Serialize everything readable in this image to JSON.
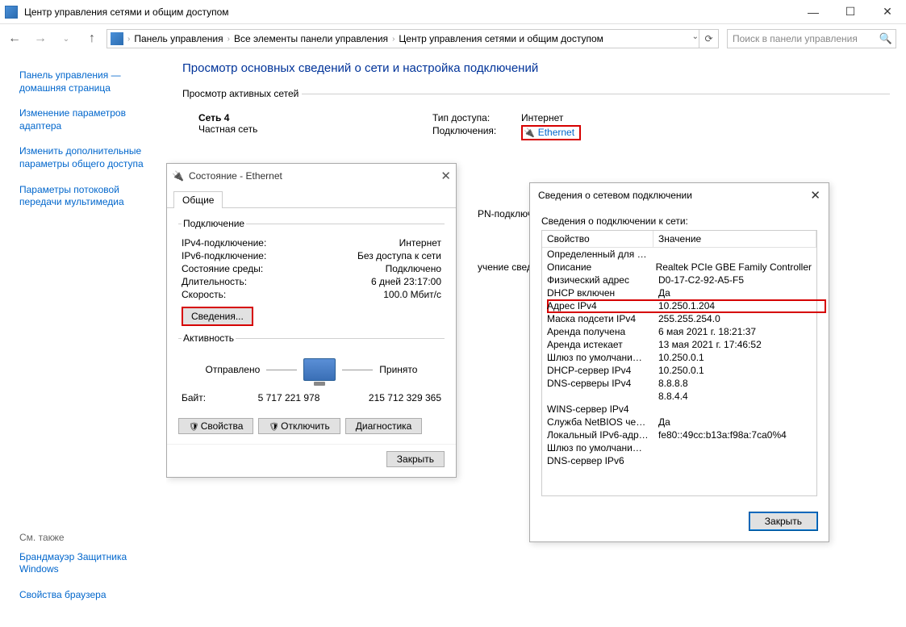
{
  "window": {
    "title": "Центр управления сетями и общим доступом",
    "minimize": "—",
    "maximize": "☐",
    "close": "✕"
  },
  "nav": {
    "back": "←",
    "forward": "→",
    "up": "↑",
    "refresh": "⟳",
    "dropdown": "⌄",
    "breadcrumb": [
      "Панель управления",
      "Все элементы панели управления",
      "Центр управления сетями и общим доступом"
    ],
    "sep": "›"
  },
  "search": {
    "placeholder": "Поиск в панели управления"
  },
  "sidebar": {
    "items": [
      "Панель управления — домашняя страница",
      "Изменение параметров адаптера",
      "Изменить дополнительные параметры общего доступа",
      "Параметры потоковой передачи мультимедиа"
    ],
    "see_also_title": "См. также",
    "see_also": [
      "Брандмауэр Защитника Windows",
      "Свойства браузера"
    ]
  },
  "content": {
    "page_title": "Просмотр основных сведений о сети и настройка подключений",
    "active_networks_title": "Просмотр активных сетей",
    "network_name": "Сеть 4",
    "network_type": "Частная сеть",
    "access_label": "Тип доступа:",
    "access_value": "Интернет",
    "connections_label": "Подключения:",
    "connections_value": "Ethernet",
    "change_settings_title_1": "PN-подключении",
    "change_settings_title_2": "учение сведени"
  },
  "status_dlg": {
    "title": "Состояние - Ethernet",
    "tab_general": "Общие",
    "group_connection": "Подключение",
    "ipv4_label": "IPv4-подключение:",
    "ipv4_value": "Интернет",
    "ipv6_label": "IPv6-подключение:",
    "ipv6_value": "Без доступа к сети",
    "media_label": "Состояние среды:",
    "media_value": "Подключено",
    "duration_label": "Длительность:",
    "duration_value": "6 дней 23:17:00",
    "speed_label": "Скорость:",
    "speed_value": "100.0 Мбит/с",
    "details_btn": "Сведения...",
    "group_activity": "Активность",
    "sent": "Отправлено",
    "received": "Принято",
    "bytes_label": "Байт:",
    "bytes_sent": "5 717 221 978",
    "bytes_recv": "215 712 329 365",
    "props_btn": "Свойства",
    "disable_btn": "Отключить",
    "diag_btn": "Диагностика",
    "close_btn": "Закрыть"
  },
  "details_dlg": {
    "title": "Сведения о сетевом подключении",
    "subtitle": "Сведения о подключении к сети:",
    "col_property": "Свойство",
    "col_value": "Значение",
    "close_btn": "Закрыть",
    "rows": [
      {
        "p": "Определенный для по...",
        "v": ""
      },
      {
        "p": "Описание",
        "v": "Realtek PCIe GBE Family Controller"
      },
      {
        "p": "Физический адрес",
        "v": "D0-17-C2-92-A5-F5"
      },
      {
        "p": "DHCP включен",
        "v": "Да"
      },
      {
        "p": "Адрес IPv4",
        "v": "10.250.1.204"
      },
      {
        "p": "Маска подсети IPv4",
        "v": "255.255.254.0"
      },
      {
        "p": "Аренда получена",
        "v": "6 мая 2021 г. 18:21:37"
      },
      {
        "p": "Аренда истекает",
        "v": "13 мая 2021 г. 17:46:52"
      },
      {
        "p": "Шлюз по умолчанию IP...",
        "v": "10.250.0.1"
      },
      {
        "p": "DHCP-сервер IPv4",
        "v": "10.250.0.1"
      },
      {
        "p": "DNS-серверы IPv4",
        "v": "8.8.8.8"
      },
      {
        "p": "",
        "v": "8.8.4.4"
      },
      {
        "p": "WINS-сервер IPv4",
        "v": ""
      },
      {
        "p": "Служба NetBIOS через...",
        "v": "Да"
      },
      {
        "p": "Локальный IPv6-адрес...",
        "v": "fe80::49cc:b13a:f98a:7ca0%4"
      },
      {
        "p": "Шлюз по умолчанию IP...",
        "v": ""
      },
      {
        "p": "DNS-сервер IPv6",
        "v": ""
      }
    ],
    "highlight_index": 4
  }
}
